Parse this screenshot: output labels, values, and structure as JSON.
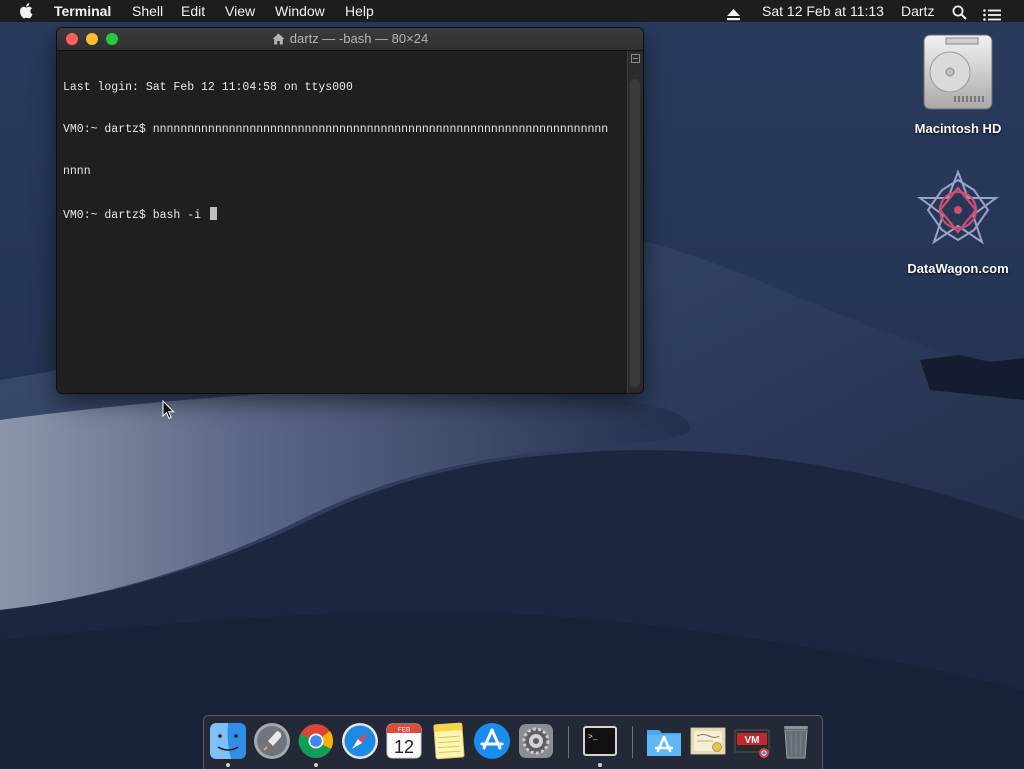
{
  "menubar": {
    "apple_icon": "apple-icon",
    "app_name": "Terminal",
    "menus": [
      "Shell",
      "Edit",
      "View",
      "Window",
      "Help"
    ],
    "datetime": "Sat 12 Feb at  11:13",
    "user": "Dartz",
    "status_icons": [
      "eject-icon",
      "search-icon",
      "notification-center-icon"
    ]
  },
  "terminal": {
    "title": "dartz — -bash — 80×24",
    "lines": [
      "Last login: Sat Feb 12 11:04:58 on ttys000",
      "VM0:~ dartz$ nnnnnnnnnnnnnnnnnnnnnnnnnnnnnnnnnnnnnnnnnnnnnnnnnnnnnnnnnnnnnnnnnn",
      "nnnn",
      "VM0:~ dartz$ bash -i "
    ]
  },
  "desktop": {
    "icons": [
      {
        "label": "Macintosh HD",
        "icon": "hard-drive-icon"
      },
      {
        "label": "DataWagon.com",
        "icon": "datawagon-icon"
      }
    ]
  },
  "dock": {
    "apps": [
      {
        "name": "Finder",
        "icon": "finder-icon",
        "running": true
      },
      {
        "name": "Launchpad",
        "icon": "launchpad-icon",
        "running": false
      },
      {
        "name": "Google Chrome",
        "icon": "chrome-icon",
        "running": true
      },
      {
        "name": "Safari",
        "icon": "safari-icon",
        "running": false
      },
      {
        "name": "Calendar",
        "icon": "calendar-icon",
        "running": false,
        "month": "FEB",
        "day": "12"
      },
      {
        "name": "Notes",
        "icon": "notes-icon",
        "running": false
      },
      {
        "name": "App Store",
        "icon": "app-store-icon",
        "running": false
      },
      {
        "name": "System Preferences",
        "icon": "system-preferences-icon",
        "running": false
      },
      {
        "name": "Terminal",
        "icon": "terminal-icon",
        "running": true
      },
      {
        "name": "Applications",
        "icon": "applications-folder-icon",
        "running": false
      },
      {
        "name": "Certificate",
        "icon": "certificate-icon",
        "running": false
      },
      {
        "name": "VM Installer",
        "icon": "vm-installer-icon",
        "running": false
      },
      {
        "name": "Trash",
        "icon": "trash-icon",
        "running": false
      }
    ]
  },
  "colors": {
    "close": "#fe5f57",
    "minimize": "#febc2e",
    "zoom": "#28c840",
    "terminal_bg": "#1f1f1f",
    "menubar_bg": "#1d1d1f"
  }
}
